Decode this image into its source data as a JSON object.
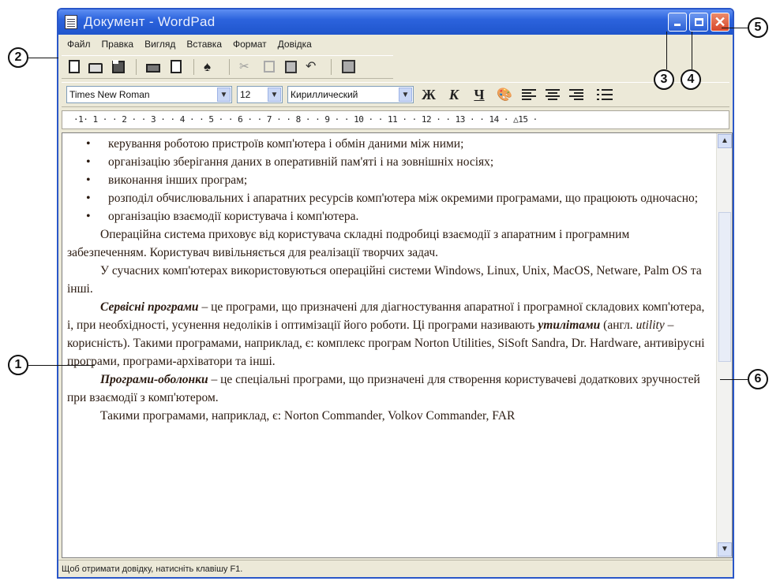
{
  "window": {
    "title": "Документ - WordPad",
    "status": "Щоб отримати довідку, натисніть клавішу F1."
  },
  "menu": [
    "Файл",
    "Правка",
    "Вигляд",
    "Вставка",
    "Формат",
    "Довідка"
  ],
  "toolbar": {
    "icons": [
      "new-icon",
      "open-icon",
      "save-icon",
      "print-icon",
      "print-preview-icon",
      "find-icon",
      "cut-icon",
      "copy-icon",
      "paste-icon",
      "undo-icon",
      "date-time-icon"
    ]
  },
  "format": {
    "font": "Times New Roman",
    "size": "12",
    "script": "Кириллический",
    "bold": "Ж",
    "italic": "К",
    "underline": "Ч"
  },
  "ruler": "·1·   1 · · 2 · · 3 · · 4 · · 5 · · 6 · · 7 · · 8 · · 9 · · 10 · · 11 · · 12 · · 13 · · 14 · △15 ·",
  "document": {
    "bullets": [
      "керування роботою пристроїв комп'ютера і обмін даними між ними;",
      "організацію зберігання даних в оперативній пам'яті і на зовнішніх носіях;",
      "виконання інших програм;",
      "розподіл обчислювальних і апаратних ресурсів комп'ютера між окремими програмами, що працюють одночасно;",
      "організацію взаємодії користувача і комп'ютера."
    ],
    "p1": "Операційна система приховує від користувача складні подробиці взаємодії з апаратним і програмним забезпеченням. Користувач вивільняється для реалізації творчих задач.",
    "p2": "У сучасних комп'ютерах використовуються операційні системи Windows, Linux, Unix, MacOS, Netware, Palm OS та інші.",
    "p3_term": "Сервісні програми",
    "p3_a": " – це програми, що призначені для діагностування апаратної і програмної складових комп'ютера, і, при необхідності, усунення недоліків і оптимізації його роботи. Ці програми називають ",
    "p3_term2": "утилітами",
    "p3_b": " (англ. ",
    "p3_eng": "utility",
    "p3_c": " – корисність). Такими програмами, наприклад, є: комплекс програм Norton Utilities, SiSoft Sandra, Dr. Hardware, антивірусні програми, програми-архіватори та інші.",
    "p4_term": "Програми-оболонки",
    "p4_a": " – це спеціальні програми, що призначені для створення користувачеві додаткових зручностей при взаємодії з комп'ютером.",
    "p5": "Такими програмами, наприклад, є: Norton Commander, Volkov Commander, FAR"
  },
  "callouts": [
    "1",
    "2",
    "3",
    "4",
    "5",
    "6"
  ]
}
